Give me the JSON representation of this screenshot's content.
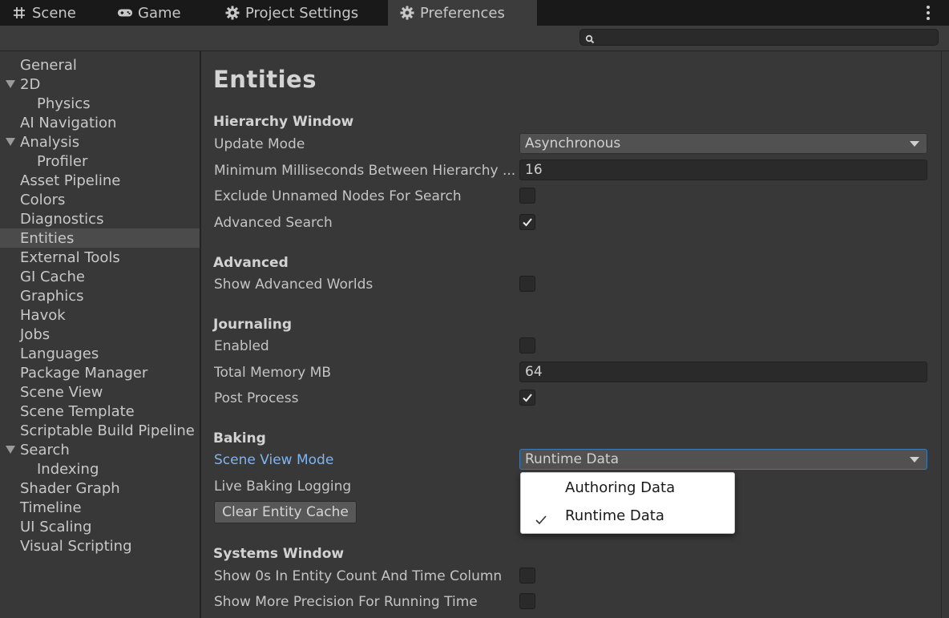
{
  "tabs": [
    {
      "label": "Scene",
      "icon": "grid-icon"
    },
    {
      "label": "Game",
      "icon": "gamepad-icon"
    },
    {
      "label": "Project Settings",
      "icon": "gear-icon"
    },
    {
      "label": "Preferences",
      "icon": "gear-icon",
      "active": true
    }
  ],
  "search": {
    "placeholder": "",
    "value": ""
  },
  "sidebar": {
    "items": [
      {
        "label": "General"
      },
      {
        "label": "2D",
        "expanded": true
      },
      {
        "label": "Physics",
        "indent": true
      },
      {
        "label": "AI Navigation"
      },
      {
        "label": "Analysis",
        "expanded": true
      },
      {
        "label": "Profiler",
        "indent": true
      },
      {
        "label": "Asset Pipeline"
      },
      {
        "label": "Colors"
      },
      {
        "label": "Diagnostics"
      },
      {
        "label": "Entities",
        "selected": true
      },
      {
        "label": "External Tools"
      },
      {
        "label": "GI Cache"
      },
      {
        "label": "Graphics"
      },
      {
        "label": "Havok"
      },
      {
        "label": "Jobs"
      },
      {
        "label": "Languages"
      },
      {
        "label": "Package Manager"
      },
      {
        "label": "Scene View"
      },
      {
        "label": "Scene Template"
      },
      {
        "label": "Scriptable Build Pipeline"
      },
      {
        "label": "Search",
        "expanded": true
      },
      {
        "label": "Indexing",
        "indent": true
      },
      {
        "label": "Shader Graph"
      },
      {
        "label": "Timeline"
      },
      {
        "label": "UI Scaling"
      },
      {
        "label": "Visual Scripting"
      }
    ]
  },
  "main": {
    "title": "Entities",
    "hierarchy": {
      "header": "Hierarchy Window",
      "update_mode_label": "Update Mode",
      "update_mode_value": "Asynchronous",
      "min_ms_label": "Minimum Milliseconds Between Hierarchy ...",
      "min_ms_value": "16",
      "exclude_unnamed_label": "Exclude Unnamed Nodes For Search",
      "exclude_unnamed_checked": false,
      "advanced_search_label": "Advanced Search",
      "advanced_search_checked": true
    },
    "advanced": {
      "header": "Advanced",
      "show_worlds_label": "Show Advanced Worlds",
      "show_worlds_checked": false
    },
    "journaling": {
      "header": "Journaling",
      "enabled_label": "Enabled",
      "enabled_checked": false,
      "total_memory_label": "Total Memory MB",
      "total_memory_value": "64",
      "post_process_label": "Post Process",
      "post_process_checked": true
    },
    "baking": {
      "header": "Baking",
      "scene_view_mode_label": "Scene View Mode",
      "scene_view_mode_value": "Runtime Data",
      "live_baking_label": "Live Baking Logging",
      "clear_cache_button": "Clear Entity Cache",
      "popup_options": [
        {
          "label": "Authoring Data",
          "checked": false
        },
        {
          "label": "Runtime Data",
          "checked": true
        }
      ]
    },
    "systems": {
      "header": "Systems Window",
      "show_zeros_label": "Show 0s In Entity Count And Time Column",
      "show_zeros_checked": false,
      "more_precision_label": "Show More Precision For Running Time",
      "more_precision_checked": false
    }
  },
  "colors": {
    "background": "#383838",
    "tab_bar": "#191919",
    "accent_link": "#7fb4f0",
    "focus_border": "#3a79bb"
  }
}
